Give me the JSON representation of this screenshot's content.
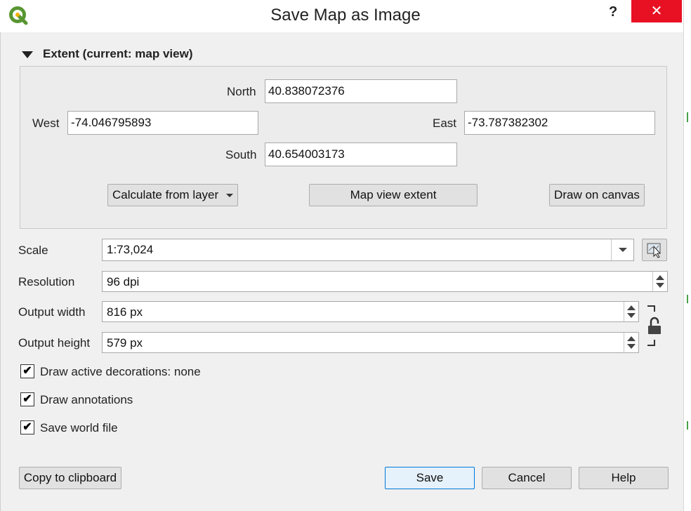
{
  "window": {
    "title": "Save Map as Image",
    "help_glyph": "?",
    "close_glyph": "✕"
  },
  "extent": {
    "group_title": "Extent (current: map view)",
    "north_label": "North",
    "north_value": "40.838072376",
    "west_label": "West",
    "west_value": "-74.046795893",
    "east_label": "East",
    "east_value": "-73.787382302",
    "south_label": "South",
    "south_value": "40.654003173",
    "calc_from_layer_label": "Calculate from layer",
    "map_view_extent_label": "Map view extent",
    "draw_on_canvas_label": "Draw on canvas"
  },
  "settings": {
    "scale_label": "Scale",
    "scale_value": "1:73,024",
    "resolution_label": "Resolution",
    "resolution_value": "96 dpi",
    "width_label": "Output width",
    "width_value": "816 px",
    "height_label": "Output height",
    "height_value": "579 px"
  },
  "options": {
    "decorations_label": "Draw active decorations: none",
    "decorations_checked": true,
    "annotations_label": "Draw annotations",
    "annotations_checked": true,
    "world_file_label": "Save world file",
    "world_file_checked": true,
    "check_glyph": "✔"
  },
  "footer": {
    "copy_label": "Copy to clipboard",
    "save_label": "Save",
    "cancel_label": "Cancel",
    "help_label": "Help"
  },
  "colors": {
    "qgis_green": "#589632",
    "qgis_yellow": "#f0b000",
    "close_red": "#e81123",
    "default_button_border": "#0078d7"
  },
  "icons": {
    "app": "qgis-logo-icon",
    "map_tool": "map-pointer-icon",
    "lock": "padlock-icon"
  }
}
